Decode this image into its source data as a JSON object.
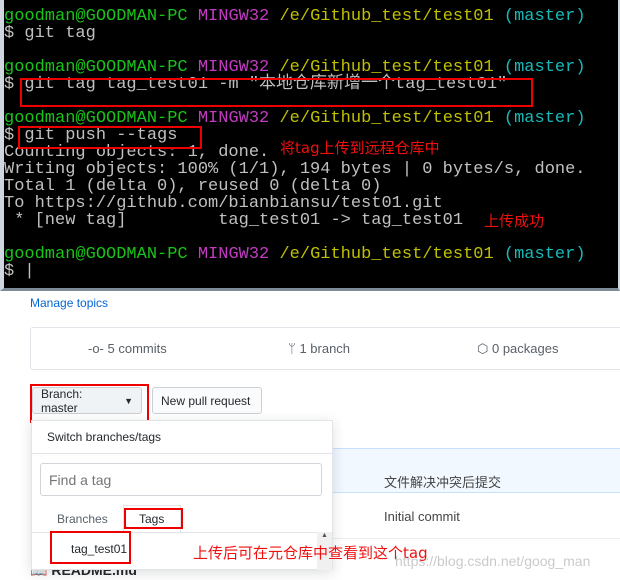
{
  "terminal": {
    "prompt": {
      "user": "goodman@GOODMAN-PC",
      "env": "MINGW32",
      "path": "/e/Github_test/test01",
      "branch": "(master)"
    },
    "lines": [
      "$ git tag",
      "$ git tag tag_test01 -m \"本地仓库新增一个tag_test01\"",
      "$ git push --tags",
      "Counting objects: 1, done.",
      "Writing objects: 100% (1/1), 194 bytes | 0 bytes/s, done.",
      "Total 1 (delta 0), reused 0 (delta 0)",
      "To https://github.com/bianbiansu/test01.git",
      " * [new tag]         tag_test01 -> tag_test01",
      "$ |"
    ],
    "notes": {
      "push": "将tag上传到远程仓库中",
      "success": "上传成功"
    }
  },
  "github": {
    "manage_topics": "Manage topics",
    "stats": {
      "commits": "5 commits",
      "branches": "1 branch",
      "packages": "0 packages"
    },
    "branch_button": "Branch: master",
    "new_pull_request": "New pull request",
    "dropdown": {
      "title": "Switch branches/tags",
      "search_placeholder": "Find a tag",
      "tabs": [
        "Branches",
        "Tags"
      ],
      "items": [
        "tag_test01"
      ]
    },
    "commits": [
      "文件解决冲突后提交",
      "Initial commit"
    ],
    "readme": "README.md",
    "note": "上传后可在元仓库中查看到这个tag",
    "watermark": "https://blog.csdn.net/goog_man"
  }
}
